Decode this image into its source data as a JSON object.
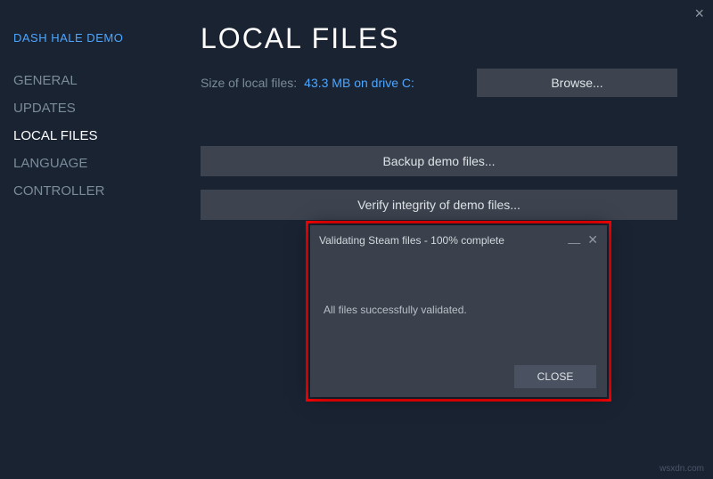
{
  "header": {
    "game_title": "DASH HALE DEMO"
  },
  "sidebar": {
    "items": [
      {
        "label": "GENERAL",
        "active": false
      },
      {
        "label": "UPDATES",
        "active": false
      },
      {
        "label": "LOCAL FILES",
        "active": true
      },
      {
        "label": "LANGUAGE",
        "active": false
      },
      {
        "label": "CONTROLLER",
        "active": false
      }
    ]
  },
  "main": {
    "title": "LOCAL FILES",
    "size_label": "Size of local files:",
    "size_value": "43.3 MB on drive C:",
    "browse_label": "Browse...",
    "backup_label": "Backup demo files...",
    "verify_label": "Verify integrity of demo files..."
  },
  "dialog": {
    "title": "Validating Steam files - 100% complete",
    "message": "All files successfully validated.",
    "close_label": "CLOSE"
  },
  "watermark": "wsxdn.com"
}
